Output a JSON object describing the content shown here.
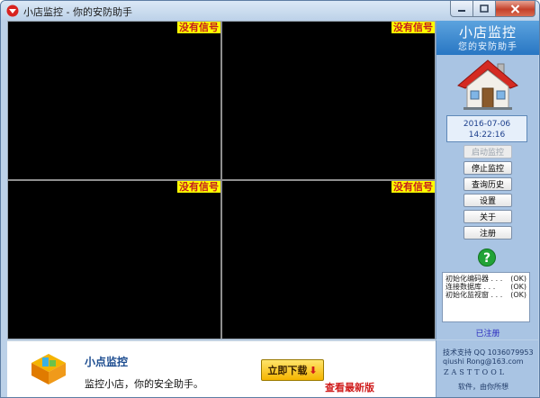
{
  "window": {
    "title": "小店监控 - 你的安防助手"
  },
  "video": {
    "no_signal": "没有信号",
    "cells": [
      "cell-1",
      "cell-2",
      "cell-3",
      "cell-4"
    ]
  },
  "sidebar": {
    "banner_title": "小店监控",
    "banner_subtitle": "您的安防助手",
    "date": "2016-07-06",
    "time": "14:22:16",
    "buttons": [
      {
        "label": "启动监控",
        "disabled": true
      },
      {
        "label": "停止监控",
        "disabled": false
      },
      {
        "label": "查询历史",
        "disabled": false
      },
      {
        "label": "设置",
        "disabled": false
      },
      {
        "label": "关于",
        "disabled": false
      },
      {
        "label": "注册",
        "disabled": false
      }
    ],
    "log": [
      {
        "text": "初始化编码器 . . .",
        "status": "(OK)"
      },
      {
        "text": "连接数据库 . . .",
        "status": "(OK)"
      },
      {
        "text": "初始化监视窗 . . .",
        "status": "(OK)"
      }
    ],
    "registered": "已注册"
  },
  "ad": {
    "name": "小点监控",
    "description": "监控小店，你的安全助手。",
    "download_label": "立即下载",
    "latest_label": "查看最新版"
  },
  "support": {
    "line1": "技术支持 QQ 1036079953",
    "line2": "qiushi Rong@163.com",
    "brand": "ZASTTOOL",
    "line3": "软件，由你所想"
  },
  "colors": {
    "no_signal_bg": "#ffff00",
    "no_signal_text": "#c41e1e",
    "banner": "#2876c3",
    "panel": "#a9c4e3"
  }
}
